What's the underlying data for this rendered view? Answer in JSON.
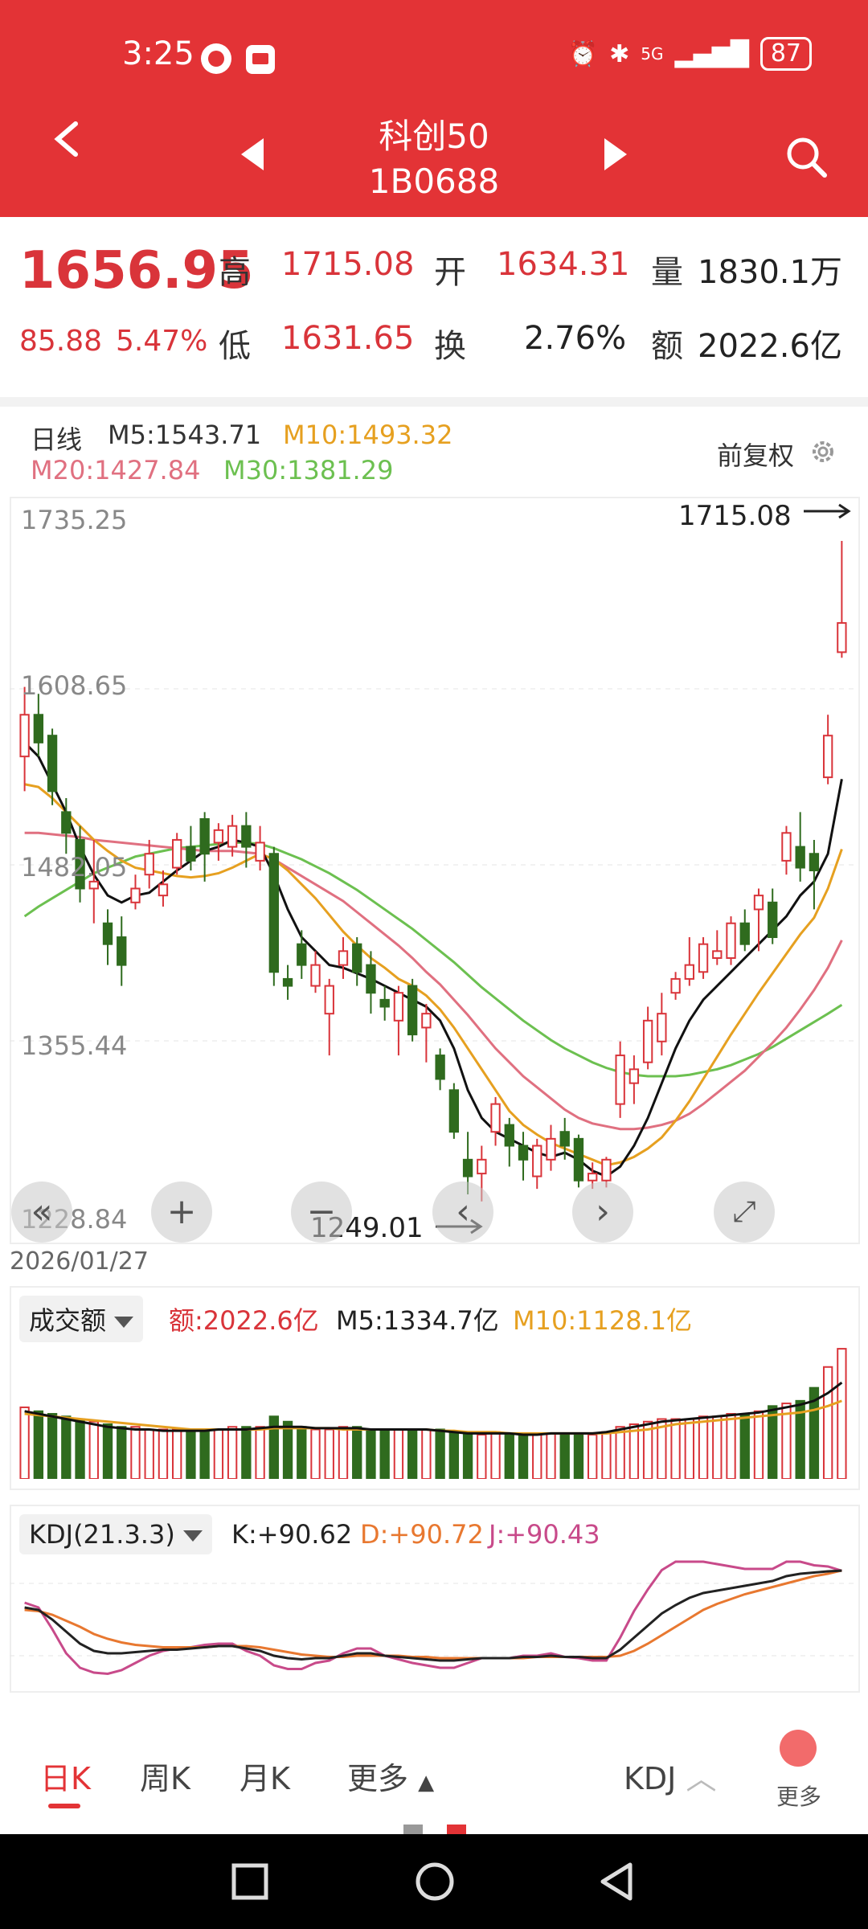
{
  "status": {
    "time": "3:25",
    "battery": "87",
    "network": "5G"
  },
  "nav": {
    "title": "科创50",
    "code": "1B0688"
  },
  "quote": {
    "price": "1656.95",
    "change": "85.88",
    "change_pct": "5.47%",
    "high_label": "高",
    "high": "1715.08",
    "open_label": "开",
    "open": "1634.31",
    "vol_label": "量",
    "vol": "1830.1万",
    "low_label": "低",
    "low": "1631.65",
    "turnover_label": "换",
    "turnover": "2.76%",
    "amount_label": "额",
    "amount": "2022.6亿"
  },
  "ma": {
    "period": "日线",
    "m5": "M5:1543.71",
    "m10": "M10:1493.32",
    "m20": "M20:1427.84",
    "m30": "M30:1381.29",
    "adjust": "前复权"
  },
  "kline": {
    "y_labels": [
      "1735.25",
      "1608.65",
      "1482.05",
      "1355.44",
      "1228.84"
    ],
    "high_marker": "1715.08",
    "low_marker": "1249.01",
    "date": "2026/01/27"
  },
  "volume": {
    "selector": "成交额",
    "amount": "额:2022.6亿",
    "m5": "M5:1334.7亿",
    "m10": "M10:1128.1亿"
  },
  "kdj": {
    "selector": "KDJ(21.3.3)",
    "k": "K:+90.62",
    "d": "D:+90.72",
    "j": "J:+90.43"
  },
  "tabs": {
    "day": "日K",
    "week": "周K",
    "month": "月K",
    "more": "更多",
    "indicator": "KDJ",
    "more2": "更多"
  },
  "colors": {
    "up": "#d9343a",
    "down": "#2f6b1e",
    "m5": "#111111",
    "m10": "#e6a020",
    "m20": "#e07080",
    "m30": "#6cc050",
    "k": "#222222",
    "d": "#e87830",
    "j": "#c84a8a"
  },
  "chart_data": {
    "type": "candlestick",
    "ylim": [
      1228.84,
      1735.25
    ],
    "candles": [
      {
        "o": 1560,
        "c": 1590,
        "h": 1610,
        "l": 1535
      },
      {
        "o": 1590,
        "c": 1570,
        "h": 1605,
        "l": 1560
      },
      {
        "o": 1575,
        "c": 1535,
        "h": 1580,
        "l": 1525
      },
      {
        "o": 1520,
        "c": 1505,
        "h": 1530,
        "l": 1490
      },
      {
        "o": 1500,
        "c": 1465,
        "h": 1510,
        "l": 1455
      },
      {
        "o": 1465,
        "c": 1470,
        "h": 1500,
        "l": 1440
      },
      {
        "o": 1440,
        "c": 1425,
        "h": 1450,
        "l": 1410
      },
      {
        "o": 1430,
        "c": 1410,
        "h": 1445,
        "l": 1395
      },
      {
        "o": 1455,
        "c": 1465,
        "h": 1475,
        "l": 1450
      },
      {
        "o": 1475,
        "c": 1490,
        "h": 1500,
        "l": 1465
      },
      {
        "o": 1460,
        "c": 1468,
        "h": 1478,
        "l": 1452
      },
      {
        "o": 1480,
        "c": 1500,
        "h": 1505,
        "l": 1475
      },
      {
        "o": 1495,
        "c": 1485,
        "h": 1510,
        "l": 1478
      },
      {
        "o": 1515,
        "c": 1490,
        "h": 1520,
        "l": 1470
      },
      {
        "o": 1498,
        "c": 1507,
        "h": 1512,
        "l": 1485
      },
      {
        "o": 1495,
        "c": 1510,
        "h": 1518,
        "l": 1488
      },
      {
        "o": 1510,
        "c": 1495,
        "h": 1520,
        "l": 1480
      },
      {
        "o": 1485,
        "c": 1498,
        "h": 1510,
        "l": 1478
      },
      {
        "o": 1490,
        "c": 1405,
        "h": 1495,
        "l": 1395
      },
      {
        "o": 1400,
        "c": 1395,
        "h": 1410,
        "l": 1385
      },
      {
        "o": 1425,
        "c": 1410,
        "h": 1435,
        "l": 1400
      },
      {
        "o": 1395,
        "c": 1410,
        "h": 1420,
        "l": 1390
      },
      {
        "o": 1375,
        "c": 1395,
        "h": 1400,
        "l": 1345
      },
      {
        "o": 1410,
        "c": 1420,
        "h": 1430,
        "l": 1400
      },
      {
        "o": 1425,
        "c": 1405,
        "h": 1430,
        "l": 1395
      },
      {
        "o": 1410,
        "c": 1390,
        "h": 1420,
        "l": 1375
      },
      {
        "o": 1385,
        "c": 1380,
        "h": 1395,
        "l": 1370
      },
      {
        "o": 1370,
        "c": 1390,
        "h": 1395,
        "l": 1345
      },
      {
        "o": 1395,
        "c": 1360,
        "h": 1400,
        "l": 1355
      },
      {
        "o": 1365,
        "c": 1375,
        "h": 1382,
        "l": 1340
      },
      {
        "o": 1345,
        "c": 1328,
        "h": 1350,
        "l": 1320
      },
      {
        "o": 1320,
        "c": 1290,
        "h": 1325,
        "l": 1285
      },
      {
        "o": 1270,
        "c": 1258,
        "h": 1290,
        "l": 1245
      },
      {
        "o": 1260,
        "c": 1270,
        "h": 1280,
        "l": 1240
      },
      {
        "o": 1290,
        "c": 1310,
        "h": 1315,
        "l": 1280
      },
      {
        "o": 1295,
        "c": 1280,
        "h": 1300,
        "l": 1265
      },
      {
        "o": 1280,
        "c": 1270,
        "h": 1290,
        "l": 1255
      },
      {
        "o": 1258,
        "c": 1280,
        "h": 1285,
        "l": 1249
      },
      {
        "o": 1270,
        "c": 1285,
        "h": 1295,
        "l": 1262
      },
      {
        "o": 1290,
        "c": 1280,
        "h": 1300,
        "l": 1270
      },
      {
        "o": 1285,
        "c": 1255,
        "h": 1288,
        "l": 1250
      },
      {
        "o": 1255,
        "c": 1260,
        "h": 1268,
        "l": 1249
      },
      {
        "o": 1255,
        "c": 1270,
        "h": 1272,
        "l": 1250
      },
      {
        "o": 1310,
        "c": 1345,
        "h": 1355,
        "l": 1300
      },
      {
        "o": 1325,
        "c": 1335,
        "h": 1345,
        "l": 1310
      },
      {
        "o": 1340,
        "c": 1370,
        "h": 1380,
        "l": 1335
      },
      {
        "o": 1355,
        "c": 1375,
        "h": 1390,
        "l": 1345
      },
      {
        "o": 1390,
        "c": 1400,
        "h": 1405,
        "l": 1385
      },
      {
        "o": 1400,
        "c": 1410,
        "h": 1430,
        "l": 1395
      },
      {
        "o": 1405,
        "c": 1425,
        "h": 1430,
        "l": 1400
      },
      {
        "o": 1415,
        "c": 1420,
        "h": 1435,
        "l": 1410
      },
      {
        "o": 1415,
        "c": 1440,
        "h": 1445,
        "l": 1410
      },
      {
        "o": 1440,
        "c": 1425,
        "h": 1450,
        "l": 1420
      },
      {
        "o": 1450,
        "c": 1460,
        "h": 1465,
        "l": 1420
      },
      {
        "o": 1455,
        "c": 1430,
        "h": 1465,
        "l": 1425
      },
      {
        "o": 1485,
        "c": 1505,
        "h": 1510,
        "l": 1475
      },
      {
        "o": 1495,
        "c": 1480,
        "h": 1520,
        "l": 1470
      },
      {
        "o": 1490,
        "c": 1478,
        "h": 1500,
        "l": 1450
      },
      {
        "o": 1545,
        "c": 1575,
        "h": 1590,
        "l": 1540
      },
      {
        "o": 1635,
        "c": 1656,
        "h": 1715,
        "l": 1631
      }
    ],
    "ma5": [
      1570,
      1560,
      1540,
      1520,
      1495,
      1475,
      1460,
      1455,
      1460,
      1462,
      1470,
      1478,
      1485,
      1492,
      1495,
      1500,
      1498,
      1495,
      1475,
      1450,
      1430,
      1420,
      1410,
      1408,
      1404,
      1400,
      1395,
      1390,
      1385,
      1380,
      1370,
      1350,
      1320,
      1300,
      1290,
      1285,
      1280,
      1275,
      1272,
      1275,
      1270,
      1262,
      1258,
      1265,
      1280,
      1300,
      1325,
      1350,
      1370,
      1385,
      1395,
      1405,
      1415,
      1425,
      1435,
      1445,
      1460,
      1470,
      1490,
      1543.71
    ],
    "ma10": [
      1540,
      1538,
      1530,
      1520,
      1510,
      1500,
      1492,
      1485,
      1480,
      1478,
      1476,
      1474,
      1473,
      1474,
      1476,
      1480,
      1485,
      1490,
      1486,
      1478,
      1468,
      1458,
      1446,
      1434,
      1424,
      1415,
      1408,
      1400,
      1395,
      1388,
      1378,
      1365,
      1350,
      1335,
      1320,
      1305,
      1295,
      1288,
      1282,
      1278,
      1274,
      1270,
      1266,
      1268,
      1272,
      1278,
      1286,
      1298,
      1312,
      1328,
      1344,
      1360,
      1375,
      1390,
      1404,
      1418,
      1432,
      1444,
      1465,
      1493.32
    ],
    "ma20": [
      1505,
      1505,
      1504,
      1503,
      1502,
      1500,
      1499,
      1498,
      1497,
      1496,
      1495,
      1494,
      1493,
      1492,
      1492,
      1492,
      1491,
      1490,
      1486,
      1480,
      1474,
      1468,
      1462,
      1456,
      1448,
      1440,
      1432,
      1424,
      1415,
      1405,
      1396,
      1385,
      1374,
      1362,
      1350,
      1340,
      1330,
      1322,
      1314,
      1306,
      1300,
      1296,
      1294,
      1292,
      1292,
      1293,
      1295,
      1298,
      1303,
      1310,
      1318,
      1326,
      1334,
      1344,
      1354,
      1365,
      1378,
      1392,
      1408,
      1427.84
    ],
    "ma30": [
      1445,
      1452,
      1458,
      1464,
      1470,
      1476,
      1480,
      1484,
      1488,
      1490,
      1492,
      1494,
      1495,
      1496,
      1497,
      1498,
      1498,
      1497,
      1494,
      1490,
      1486,
      1481,
      1476,
      1470,
      1464,
      1457,
      1450,
      1443,
      1436,
      1428,
      1420,
      1412,
      1403,
      1394,
      1386,
      1378,
      1370,
      1363,
      1356,
      1350,
      1345,
      1340,
      1336,
      1333,
      1331,
      1330,
      1330,
      1330,
      1331,
      1333,
      1335,
      1338,
      1342,
      1346,
      1351,
      1357,
      1363,
      1369,
      1375,
      1381.29
    ],
    "volume": [
      55,
      52,
      50,
      48,
      46,
      44,
      42,
      40,
      40,
      38,
      38,
      38,
      37,
      37,
      38,
      40,
      40,
      40,
      48,
      44,
      40,
      38,
      38,
      40,
      40,
      38,
      38,
      38,
      38,
      38,
      38,
      36,
      34,
      34,
      36,
      34,
      34,
      34,
      35,
      34,
      34,
      34,
      36,
      40,
      42,
      44,
      46,
      46,
      46,
      48,
      48,
      50,
      50,
      52,
      56,
      58,
      60,
      70,
      86,
      100
    ],
    "vol_m5": [
      52,
      50,
      48,
      46,
      44,
      42,
      40,
      39,
      38,
      38,
      37,
      37,
      37,
      37,
      38,
      38,
      38,
      39,
      40,
      40,
      40,
      39,
      39,
      39,
      39,
      38,
      38,
      38,
      38,
      38,
      37,
      36,
      35,
      35,
      35,
      35,
      34,
      34,
      35,
      35,
      35,
      35,
      36,
      38,
      40,
      42,
      44,
      45,
      46,
      47,
      48,
      49,
      50,
      51,
      53,
      55,
      57,
      60,
      66,
      74
    ],
    "vol_m10": [
      50,
      49,
      48,
      47,
      46,
      45,
      44,
      43,
      42,
      41,
      40,
      39,
      38,
      38,
      38,
      38,
      38,
      38,
      39,
      39,
      39,
      39,
      39,
      38,
      38,
      38,
      38,
      38,
      38,
      38,
      37,
      37,
      36,
      36,
      36,
      35,
      35,
      35,
      35,
      35,
      35,
      35,
      35,
      36,
      37,
      38,
      40,
      42,
      43,
      44,
      45,
      46,
      47,
      48,
      49,
      50,
      51,
      53,
      56,
      60
    ],
    "k": [
      60,
      58,
      50,
      40,
      30,
      24,
      22,
      22,
      23,
      24,
      25,
      25,
      26,
      27,
      28,
      28,
      26,
      24,
      20,
      18,
      17,
      18,
      18,
      20,
      22,
      22,
      20,
      19,
      18,
      17,
      16,
      16,
      17,
      18,
      18,
      18,
      19,
      19,
      20,
      19,
      19,
      18,
      18,
      25,
      35,
      45,
      55,
      62,
      68,
      72,
      74,
      76,
      78,
      80,
      82,
      86,
      88,
      89,
      90,
      90.62
    ],
    "d": [
      58,
      57,
      54,
      49,
      44,
      38,
      34,
      31,
      29,
      28,
      27,
      27,
      27,
      27,
      28,
      28,
      28,
      27,
      25,
      23,
      21,
      20,
      19,
      19,
      20,
      20,
      20,
      20,
      19,
      19,
      18,
      18,
      18,
      18,
      18,
      18,
      18,
      19,
      19,
      19,
      19,
      19,
      19,
      20,
      24,
      30,
      37,
      44,
      51,
      58,
      63,
      67,
      71,
      74,
      77,
      80,
      83,
      86,
      88,
      90.72
    ],
    "j": [
      64,
      60,
      42,
      22,
      10,
      6,
      5,
      8,
      14,
      20,
      24,
      26,
      27,
      29,
      30,
      30,
      24,
      20,
      12,
      9,
      9,
      14,
      16,
      22,
      26,
      26,
      20,
      17,
      14,
      12,
      10,
      10,
      14,
      18,
      18,
      18,
      20,
      20,
      22,
      19,
      18,
      16,
      16,
      35,
      57,
      75,
      91,
      98,
      98,
      98,
      96,
      94,
      92,
      92,
      92,
      98,
      98,
      95,
      94,
      90.43
    ]
  }
}
